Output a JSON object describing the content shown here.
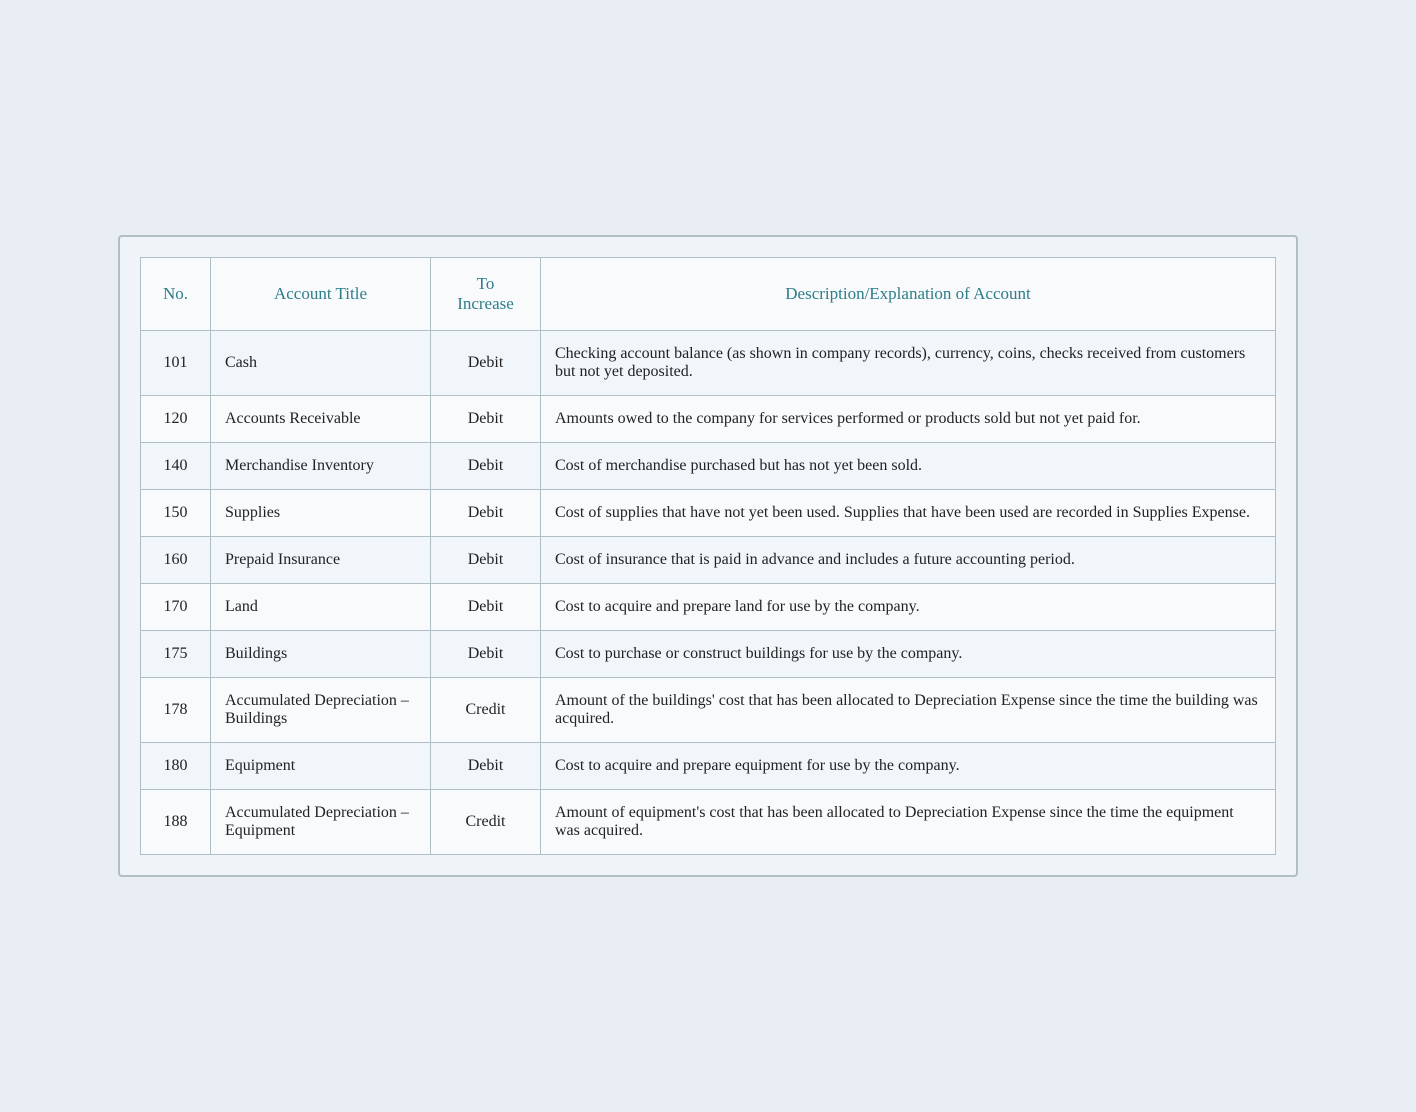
{
  "table": {
    "headers": {
      "no": "No.",
      "account_title": "Account Title",
      "to_increase": "To\nIncrease",
      "description": "Description/Explanation of Account"
    },
    "rows": [
      {
        "no": "101",
        "title": "Cash",
        "increase": "Debit",
        "description": "Checking account balance (as shown in company records), currency, coins, checks received from customers but not yet deposited."
      },
      {
        "no": "120",
        "title": "Accounts Receivable",
        "increase": "Debit",
        "description": "Amounts owed to the company for services performed or products sold but not yet paid for."
      },
      {
        "no": "140",
        "title": "Merchandise Inventory",
        "increase": "Debit",
        "description": "Cost of merchandise purchased but has not yet been sold."
      },
      {
        "no": "150",
        "title": "Supplies",
        "increase": "Debit",
        "description": "Cost of supplies that have not yet been used. Supplies that have been used are recorded in Supplies Expense."
      },
      {
        "no": "160",
        "title": "Prepaid Insurance",
        "increase": "Debit",
        "description": "Cost of insurance that is paid in advance and includes a future accounting period."
      },
      {
        "no": "170",
        "title": "Land",
        "increase": "Debit",
        "description": "Cost to acquire and prepare land for use by the company."
      },
      {
        "no": "175",
        "title": "Buildings",
        "increase": "Debit",
        "description": "Cost to purchase or construct buildings for use by the company."
      },
      {
        "no": "178",
        "title": "Accumulated Depreciation – Buildings",
        "increase": "Credit",
        "description": "Amount of the buildings' cost that has been allocated to Depreciation Expense since the time the building was acquired."
      },
      {
        "no": "180",
        "title": "Equipment",
        "increase": "Debit",
        "description": "Cost to acquire and prepare equipment for use by the company."
      },
      {
        "no": "188",
        "title": "Accumulated Depreciation – Equipment",
        "increase": "Credit",
        "description": "Amount of equipment's cost that has been allocated to Depreciation Expense since the time the equipment was acquired."
      }
    ]
  }
}
